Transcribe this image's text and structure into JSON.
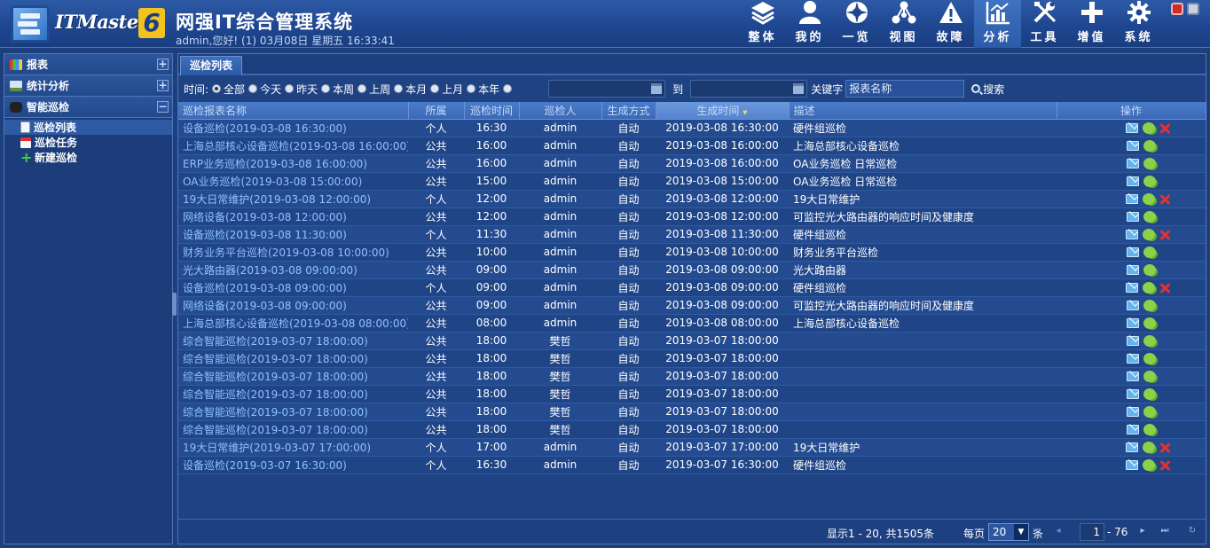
{
  "header": {
    "logo_text": "ITMaster",
    "logo_version": "6",
    "title": "网强IT综合管理系统",
    "subtitle": "admin,您好! (1) 03月08日 星期五 16:33:41"
  },
  "topnav": [
    {
      "label": "整体",
      "icon": "layers-icon"
    },
    {
      "label": "我的",
      "icon": "user-icon"
    },
    {
      "label": "一览",
      "icon": "overview-icon"
    },
    {
      "label": "视图",
      "icon": "topology-icon"
    },
    {
      "label": "故障",
      "icon": "warning-icon"
    },
    {
      "label": "分析",
      "icon": "chart-icon",
      "active": true
    },
    {
      "label": "工具",
      "icon": "tools-icon"
    },
    {
      "label": "增值",
      "icon": "plus-icon"
    },
    {
      "label": "系统",
      "icon": "gear-icon"
    }
  ],
  "sidebar": {
    "sections": [
      {
        "label": "报表",
        "toggle": "+"
      },
      {
        "label": "统计分析",
        "toggle": "+"
      },
      {
        "label": "智能巡检",
        "toggle": "−"
      }
    ],
    "items": [
      {
        "label": "巡检列表",
        "selected": true
      },
      {
        "label": "巡检任务"
      },
      {
        "label": "新建巡检"
      }
    ]
  },
  "tab": {
    "label": "巡检列表"
  },
  "filter": {
    "time_label": "时间:",
    "options": [
      "全部",
      "今天",
      "昨天",
      "本周",
      "上周",
      "本月",
      "上月",
      "本年"
    ],
    "selected": "全部",
    "to_label": "到",
    "keyword_label": "关键字",
    "keyword_value": "报表名称",
    "search_label": "搜索"
  },
  "table": {
    "columns": [
      "巡检报表名称",
      "所属",
      "巡检时间",
      "巡检人",
      "生成方式",
      "生成时间",
      "描述",
      "操作"
    ],
    "rows": [
      {
        "name": "设备巡检(2019-03-08 16:30:00)",
        "owner": "个人",
        "time": "16:30",
        "inspector": "admin",
        "mode": "自动",
        "generated": "2019-03-08 16:30:00",
        "desc": "硬件组巡检",
        "deletable": true
      },
      {
        "name": "上海总部核心设备巡检(2019-03-08 16:00:00)",
        "owner": "公共",
        "time": "16:00",
        "inspector": "admin",
        "mode": "自动",
        "generated": "2019-03-08 16:00:00",
        "desc": "上海总部核心设备巡检",
        "deletable": false
      },
      {
        "name": "ERP业务巡检(2019-03-08 16:00:00)",
        "owner": "公共",
        "time": "16:00",
        "inspector": "admin",
        "mode": "自动",
        "generated": "2019-03-08 16:00:00",
        "desc": "OA业务巡检 日常巡检",
        "deletable": false
      },
      {
        "name": "OA业务巡检(2019-03-08 15:00:00)",
        "owner": "公共",
        "time": "15:00",
        "inspector": "admin",
        "mode": "自动",
        "generated": "2019-03-08 15:00:00",
        "desc": "OA业务巡检 日常巡检",
        "deletable": false
      },
      {
        "name": "19大日常维护(2019-03-08 12:00:00)",
        "owner": "个人",
        "time": "12:00",
        "inspector": "admin",
        "mode": "自动",
        "generated": "2019-03-08 12:00:00",
        "desc": "19大日常维护",
        "deletable": true
      },
      {
        "name": "网络设备(2019-03-08 12:00:00)",
        "owner": "公共",
        "time": "12:00",
        "inspector": "admin",
        "mode": "自动",
        "generated": "2019-03-08 12:00:00",
        "desc": "可监控光大路由器的响应时间及健康度",
        "deletable": false
      },
      {
        "name": "设备巡检(2019-03-08 11:30:00)",
        "owner": "个人",
        "time": "11:30",
        "inspector": "admin",
        "mode": "自动",
        "generated": "2019-03-08 11:30:00",
        "desc": "硬件组巡检",
        "deletable": true
      },
      {
        "name": "财务业务平台巡检(2019-03-08 10:00:00)",
        "owner": "公共",
        "time": "10:00",
        "inspector": "admin",
        "mode": "自动",
        "generated": "2019-03-08 10:00:00",
        "desc": "财务业务平台巡检",
        "deletable": false
      },
      {
        "name": "光大路由器(2019-03-08 09:00:00)",
        "owner": "公共",
        "time": "09:00",
        "inspector": "admin",
        "mode": "自动",
        "generated": "2019-03-08 09:00:00",
        "desc": "光大路由器",
        "deletable": false
      },
      {
        "name": "设备巡检(2019-03-08 09:00:00)",
        "owner": "个人",
        "time": "09:00",
        "inspector": "admin",
        "mode": "自动",
        "generated": "2019-03-08 09:00:00",
        "desc": "硬件组巡检",
        "deletable": true
      },
      {
        "name": "网络设备(2019-03-08 09:00:00)",
        "owner": "公共",
        "time": "09:00",
        "inspector": "admin",
        "mode": "自动",
        "generated": "2019-03-08 09:00:00",
        "desc": "可监控光大路由器的响应时间及健康度",
        "deletable": false
      },
      {
        "name": "上海总部核心设备巡检(2019-03-08 08:00:00)",
        "owner": "公共",
        "time": "08:00",
        "inspector": "admin",
        "mode": "自动",
        "generated": "2019-03-08 08:00:00",
        "desc": "上海总部核心设备巡检",
        "deletable": false
      },
      {
        "name": "综合智能巡检(2019-03-07 18:00:00)",
        "owner": "公共",
        "time": "18:00",
        "inspector": "樊哲",
        "mode": "自动",
        "generated": "2019-03-07 18:00:00",
        "desc": "",
        "deletable": false
      },
      {
        "name": "综合智能巡检(2019-03-07 18:00:00)",
        "owner": "公共",
        "time": "18:00",
        "inspector": "樊哲",
        "mode": "自动",
        "generated": "2019-03-07 18:00:00",
        "desc": "",
        "deletable": false
      },
      {
        "name": "综合智能巡检(2019-03-07 18:00:00)",
        "owner": "公共",
        "time": "18:00",
        "inspector": "樊哲",
        "mode": "自动",
        "generated": "2019-03-07 18:00:00",
        "desc": "",
        "deletable": false
      },
      {
        "name": "综合智能巡检(2019-03-07 18:00:00)",
        "owner": "公共",
        "time": "18:00",
        "inspector": "樊哲",
        "mode": "自动",
        "generated": "2019-03-07 18:00:00",
        "desc": "",
        "deletable": false
      },
      {
        "name": "综合智能巡检(2019-03-07 18:00:00)",
        "owner": "公共",
        "time": "18:00",
        "inspector": "樊哲",
        "mode": "自动",
        "generated": "2019-03-07 18:00:00",
        "desc": "",
        "deletable": false
      },
      {
        "name": "综合智能巡检(2019-03-07 18:00:00)",
        "owner": "公共",
        "time": "18:00",
        "inspector": "樊哲",
        "mode": "自动",
        "generated": "2019-03-07 18:00:00",
        "desc": "",
        "deletable": false
      },
      {
        "name": "19大日常维护(2019-03-07 17:00:00)",
        "owner": "个人",
        "time": "17:00",
        "inspector": "admin",
        "mode": "自动",
        "generated": "2019-03-07 17:00:00",
        "desc": "19大日常维护",
        "deletable": true
      },
      {
        "name": "设备巡检(2019-03-07 16:30:00)",
        "owner": "个人",
        "time": "16:30",
        "inspector": "admin",
        "mode": "自动",
        "generated": "2019-03-07 16:30:00",
        "desc": "硬件组巡检",
        "deletable": true
      }
    ]
  },
  "pager": {
    "info": "显示1 - 20, 共1505条",
    "per_page_label": "每页",
    "per_page_value": "20",
    "per_page_unit": "条",
    "current_page": "1",
    "total_pages": "- 76"
  },
  "colors": {
    "background": "#1d3f7e",
    "header": "#1f4791",
    "link": "#8fc1ff",
    "delete": "#e23131"
  }
}
